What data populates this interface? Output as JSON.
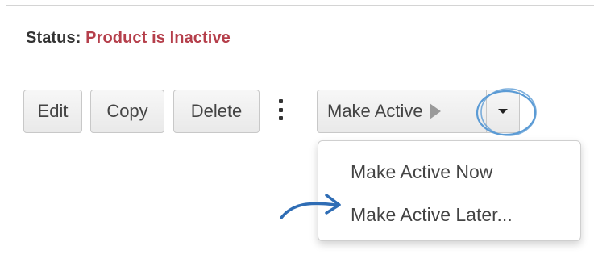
{
  "status": {
    "label": "Status:",
    "value": "Product is Inactive"
  },
  "toolbar": {
    "edit_label": "Edit",
    "copy_label": "Copy",
    "delete_label": "Delete",
    "more_icon": "vertical-ellipsis-icon",
    "make_active_label": "Make Active",
    "make_active_icon": "play-icon",
    "dropdown_icon": "caret-down-icon"
  },
  "dropdown": {
    "items": [
      {
        "label": "Make Active Now"
      },
      {
        "label": "Make Active Later..."
      }
    ]
  },
  "annotations": {
    "circle_icon": "highlight-circle",
    "arrow_icon": "curved-arrow-icon",
    "color": "#5b9bd5"
  },
  "colors": {
    "status_value": "#b53f4b",
    "button_text": "#444444",
    "border": "#c8c8c8"
  }
}
